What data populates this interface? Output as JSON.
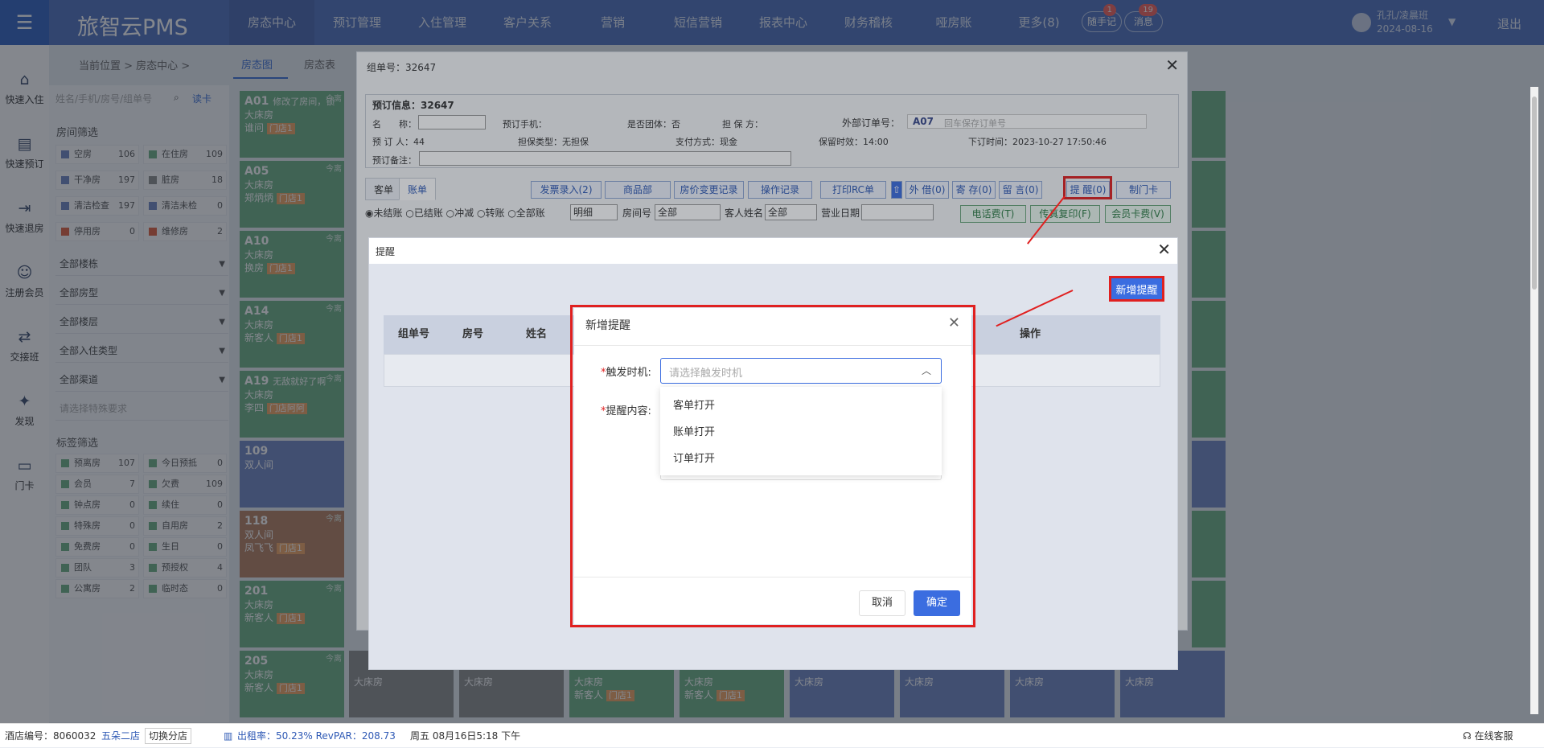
{
  "topbar": {
    "logo": "旅智云PMS",
    "nav": [
      "房态中心",
      "预订管理",
      "入住管理",
      "客户关系",
      "营销",
      "短信营销",
      "报表中心",
      "财务稽核",
      "哑房账",
      "更多(8)"
    ],
    "notes_label": "随手记",
    "notes_badge": "1",
    "msg_label": "消息",
    "msg_badge": "19",
    "user_name": "孔孔/凌晨班",
    "user_date": "2024-08-16",
    "logout": "退出"
  },
  "sidebar": [
    {
      "label": "快速入住",
      "icon": "home-icon"
    },
    {
      "label": "快速预订",
      "icon": "booking-icon"
    },
    {
      "label": "快速退房",
      "icon": "checkout-icon"
    },
    {
      "label": "注册会员",
      "icon": "member-icon"
    },
    {
      "label": "交接班",
      "icon": "shift-icon"
    },
    {
      "label": "发现",
      "icon": "discover-icon"
    },
    {
      "label": "门卡",
      "icon": "card-icon"
    }
  ],
  "breadcrumb": "当前位置 > 房态中心 >",
  "page_tabs": [
    "房态图",
    "房态表"
  ],
  "filter": {
    "search_placeholder": "姓名/手机/房号/组单号",
    "read_card": "读卡",
    "room_filter_title": "房间筛选",
    "status_cells": [
      {
        "label": "空房",
        "count": "106",
        "color": "#6d84c4"
      },
      {
        "label": "在住房",
        "count": "109",
        "color": "#6ab183"
      },
      {
        "label": "干净房",
        "count": "197",
        "color": "#6d84c4"
      },
      {
        "label": "脏房",
        "count": "18",
        "color": "#8c8c8c"
      },
      {
        "label": "清洁检查",
        "count": "197",
        "color": "#6d84c4"
      },
      {
        "label": "清洁未检",
        "count": "0",
        "color": "#6d84c4"
      },
      {
        "label": "停用房",
        "count": "0",
        "color": "#e05c3a"
      },
      {
        "label": "维修房",
        "count": "2",
        "color": "#e05c3a"
      }
    ],
    "dropdowns": [
      "全部楼栋",
      "全部房型",
      "全部楼层",
      "全部入住类型",
      "全部渠道"
    ],
    "special_placeholder": "请选择特殊要求",
    "tag_filter_title": "标签筛选",
    "tag_cells": [
      {
        "label": "预离房",
        "count": "107"
      },
      {
        "label": "今日预抵",
        "count": "0"
      },
      {
        "label": "会员",
        "count": "7"
      },
      {
        "label": "欠费",
        "count": "109"
      },
      {
        "label": "钟点房",
        "count": "0"
      },
      {
        "label": "续住",
        "count": "0"
      },
      {
        "label": "特殊房",
        "count": "0"
      },
      {
        "label": "自用房",
        "count": "2"
      },
      {
        "label": "免费房",
        "count": "0"
      },
      {
        "label": "生日",
        "count": "0"
      },
      {
        "label": "团队",
        "count": "3"
      },
      {
        "label": "预授权",
        "count": "4"
      },
      {
        "label": "公寓房",
        "count": "2"
      },
      {
        "label": "临时态",
        "count": "0"
      }
    ]
  },
  "rooms": [
    {
      "no": "A01",
      "note": "修改了房间，锁",
      "type": "大床房",
      "guest": "谁问",
      "tag": "门店1",
      "corner": "今离",
      "color": "green"
    },
    {
      "no": "A05",
      "note": "",
      "type": "大床房",
      "guest": "郑炳炳",
      "tag": "门店1",
      "corner": "今离",
      "color": "green"
    },
    {
      "no": "A10",
      "note": "",
      "type": "大床房",
      "guest": "换房",
      "tag": "门店1",
      "corner": "今离",
      "color": "green"
    },
    {
      "no": "A14",
      "note": "",
      "type": "大床房",
      "guest": "新客人",
      "tag": "门店1",
      "corner": "今离",
      "color": "green"
    },
    {
      "no": "A19",
      "note": "无敌就好了啊",
      "type": "大床房",
      "guest": "李四",
      "tag": "门店阿阿",
      "corner": "今离",
      "color": "green"
    },
    {
      "no": "109",
      "note": "",
      "type": "双人间",
      "guest": "",
      "tag": "",
      "corner": "",
      "color": "blue"
    },
    {
      "no": "118",
      "note": "",
      "type": "双人间",
      "guest": "凤飞飞",
      "tag": "门店1",
      "corner": "今离",
      "color": "brown"
    },
    {
      "no": "201",
      "note": "",
      "type": "大床房",
      "guest": "新客人",
      "tag": "门店1",
      "corner": "今离",
      "color": "green"
    },
    {
      "no": "205",
      "note": "",
      "type": "大床房",
      "guest": "新客人",
      "tag": "门店1",
      "corner": "今离",
      "color": "green"
    }
  ],
  "bottom_rooms": [
    {
      "type": "大床房",
      "guest": "",
      "tag": "",
      "color": "gray"
    },
    {
      "type": "大床房",
      "guest": "",
      "tag": "",
      "color": "gray"
    },
    {
      "type": "大床房",
      "guest": "新客人",
      "tag": "门店1",
      "color": "green"
    },
    {
      "type": "大床房",
      "guest": "新客人",
      "tag": "门店1",
      "color": "green"
    },
    {
      "type": "大床房",
      "guest": "",
      "tag": "",
      "color": "blue"
    },
    {
      "type": "大床房",
      "guest": "",
      "tag": "",
      "color": "blue"
    },
    {
      "type": "大床房",
      "guest": "",
      "tag": "",
      "color": "blue"
    },
    {
      "type": "大床房",
      "guest": "",
      "tag": "",
      "color": "blue"
    }
  ],
  "order_dialog": {
    "title": "组单号：32647",
    "info_title": "预订信息：32647",
    "name_label": "名　　称：",
    "phone_label": "预订手机：",
    "group_label": "是否团体：否",
    "guarantor_label": "担 保 方：",
    "ext_order_label": "外部订单号：",
    "ext_order_code": "A07",
    "ext_order_placeholder": "回车保存订单号",
    "booker_label": "预 订 人：44",
    "guarantee_type": "担保类型：无担保",
    "pay_method": "支付方式：现金",
    "retain_time": "保留时效：14:00",
    "order_time": "下订时间：2023-10-27 17:50:46",
    "remark_label": "预订备注：",
    "tabs": [
      "客单",
      "账单"
    ],
    "buttons": [
      "发票录入(2)",
      "商品部",
      "房价变更记录",
      "操作记录",
      "打印RC单",
      "外 借(0)",
      "寄 存(0)",
      "留 言(0)",
      "提 醒(0)",
      "制门卡"
    ],
    "radios": [
      "未结账",
      "已结账",
      "冲减",
      "转账",
      "全部账"
    ],
    "detail_select": "明细",
    "room_no_label": "房间号",
    "room_no_value": "全部",
    "guest_name_label": "客人姓名",
    "guest_name_value": "全部",
    "biz_date_label": "营业日期",
    "green_buttons": [
      "电话费(T)",
      "传真复印(F)",
      "会员卡费(V)"
    ]
  },
  "remind_dialog": {
    "title": "提醒",
    "add_button": "新增提醒",
    "columns": [
      "组单号",
      "房号",
      "姓名",
      "操作"
    ]
  },
  "modal": {
    "title": "新增提醒",
    "trigger_label": "触发时机:",
    "trigger_placeholder": "请选择触发时机",
    "content_label": "提醒内容:",
    "options": [
      "客单打开",
      "账单打开",
      "订单打开"
    ],
    "cancel": "取消",
    "confirm": "确定"
  },
  "status_bar": {
    "hotel_no": "酒店编号：8060032",
    "store": "五朵二店",
    "switch_store": "切换分店",
    "occupancy": "出租率：50.23% RevPAR：208.73",
    "datetime": "周五 08月16日5:18 下午",
    "online_service": "在线客服"
  }
}
